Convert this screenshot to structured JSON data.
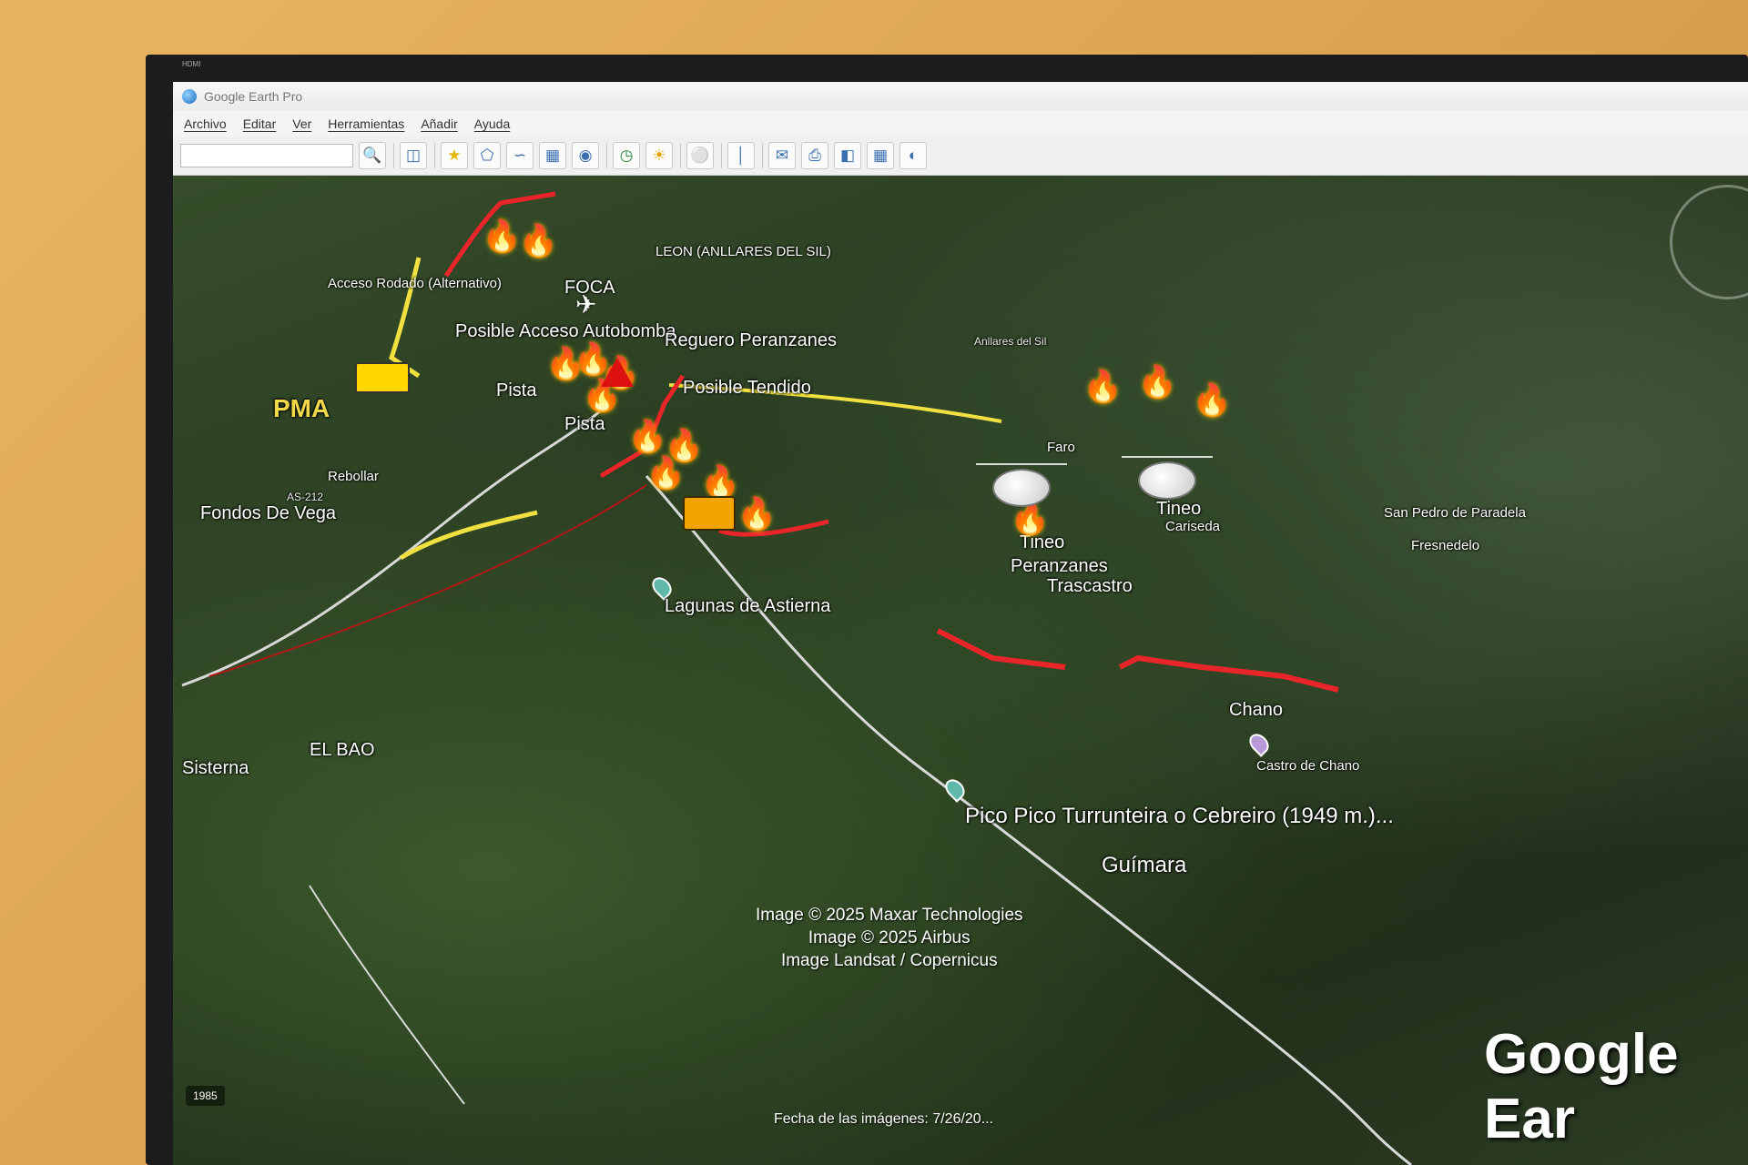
{
  "window": {
    "title": "Google Earth Pro",
    "monitor_label": "HDMI"
  },
  "menu": [
    "Archivo",
    "Editar",
    "Ver",
    "Herramientas",
    "Añadir",
    "Ayuda"
  ],
  "search": {
    "placeholder": ""
  },
  "toolbar_icons": [
    "search-icon",
    "sidebar-toggle-icon",
    "add-placemark-icon",
    "add-polygon-icon",
    "add-path-icon",
    "add-overlay-icon",
    "record-tour-icon",
    "historical-imagery-icon",
    "sun-icon",
    "planets-icon",
    "ruler-icon",
    "email-icon",
    "print-icon",
    "save-image-icon",
    "view-in-maps-icon",
    "earth-icon"
  ],
  "map": {
    "labels": {
      "acceso_rodado": "Acceso Rodado (Alternativo)",
      "foca": "FOCA",
      "leon": "LEON (ANLLARES DEL SIL)",
      "posible_acceso": "Posible Acceso Autobomba",
      "reguero": "Reguero Peranzanes",
      "posible_tendido": "Posible Tendido",
      "pista1": "Pista",
      "pista2": "Pista",
      "pma": "PMA",
      "rebollar": "Rebollar",
      "fondos": "Fondos De Vega",
      "as212": "AS-212",
      "anllares": "Anllares del Sil",
      "faro": "Faro",
      "tineo1": "Tineo",
      "tineo2": "Tineo",
      "cariseda": "Cariseda",
      "peranzanes": "Peranzanes",
      "trascastro": "Trascastro",
      "san_pedro": "San Pedro de Paradela",
      "fresnedelo": "Fresnedelo",
      "lagunas": "Lagunas de Astierna",
      "chano": "Chano",
      "castro": "Castro de Chano",
      "pico": "Pico Pico Turrunteira o Cebreiro (1949 m.)...",
      "guimara": "Guímara",
      "el_bao": "EL BAO",
      "sisterna": "Sisterna"
    },
    "credits": [
      "Image © 2025 Maxar Technologies",
      "Image © 2025 Airbus",
      "Image Landsat / Copernicus"
    ],
    "date_line": "Fecha de las imágenes: 7/26/20...",
    "logo": "Google Ear",
    "scale_badge": "1985",
    "colors": {
      "fire_line": "#e8262a",
      "access_road": "#f0e040",
      "road": "#d8d8d8"
    }
  }
}
